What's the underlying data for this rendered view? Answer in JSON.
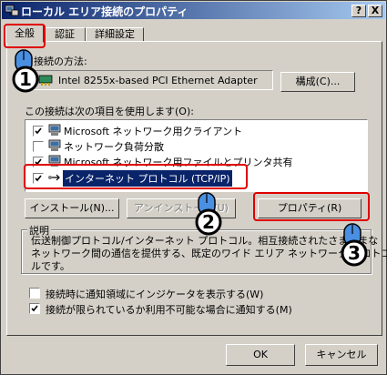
{
  "window": {
    "title": "ローカル エリア接続のプロパティ",
    "help_label": "?",
    "close_label": "X"
  },
  "tabs": [
    {
      "label": "全般",
      "active": true
    },
    {
      "label": "認証",
      "active": false
    },
    {
      "label": "詳細設定",
      "active": false
    }
  ],
  "connection": {
    "label": "接続の方法:",
    "adapter": "Intel 8255x-based PCI Ethernet Adapter",
    "configure_label": "構成(C)..."
  },
  "items": {
    "label": "この接続は次の項目を使用します(O):",
    "list": [
      {
        "label": "Microsoft ネットワーク用クライアント",
        "checked": true
      },
      {
        "label": "ネットワーク負荷分散",
        "checked": false
      },
      {
        "label": "Microsoft ネットワーク用ファイルとプリンタ共有",
        "checked": true
      },
      {
        "label": "インターネット プロトコル (TCP/IP)",
        "checked": true,
        "selected": true
      }
    ]
  },
  "buttons": {
    "install": "インストール(N)...",
    "uninstall": "アンインストール(U)",
    "properties": "プロパティ(R)"
  },
  "description": {
    "label": "説明",
    "line1": "伝送制御プロトコル/インターネット プロトコル。相互接続されたさまざまな",
    "line2": "ネットワーク間の通信を提供する、既定のワイド エリア ネットワーク プロトコ",
    "line3": "ルです。"
  },
  "options": [
    {
      "label": "接続時に通知領域にインジケータを表示する(W)",
      "checked": false
    },
    {
      "label": "接続が限られているか利用不可能な場合に通知する(M)",
      "checked": true
    }
  ],
  "footer": {
    "ok": "OK",
    "cancel": "キャンセル"
  },
  "annotations": {
    "step1": "1",
    "step2": "2",
    "step3": "3",
    "highlight_color": "#e00000"
  }
}
